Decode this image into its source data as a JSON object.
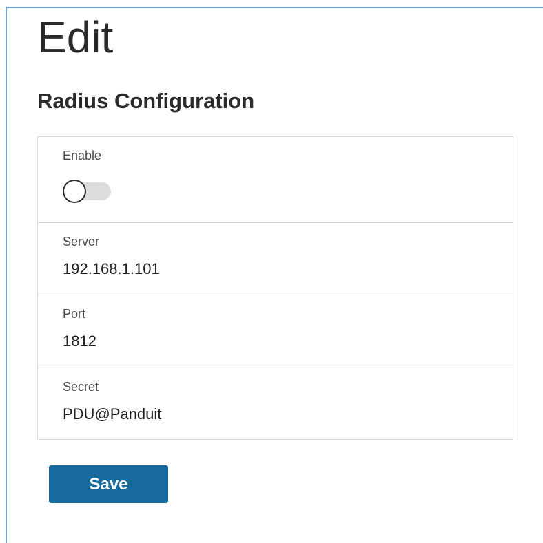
{
  "page": {
    "title": "Edit",
    "section_title": "Radius Configuration"
  },
  "form": {
    "enable": {
      "label": "Enable",
      "value": false
    },
    "server": {
      "label": "Server",
      "value": "192.168.1.101"
    },
    "port": {
      "label": "Port",
      "value": "1812"
    },
    "secret": {
      "label": "Secret",
      "value": "PDU@Panduit"
    }
  },
  "actions": {
    "save_label": "Save"
  },
  "colors": {
    "window_border": "#6f9fd0",
    "primary_button": "#176a9c",
    "panel_border": "#d8d8d8",
    "toggle_track_off": "#dcdcdc"
  }
}
